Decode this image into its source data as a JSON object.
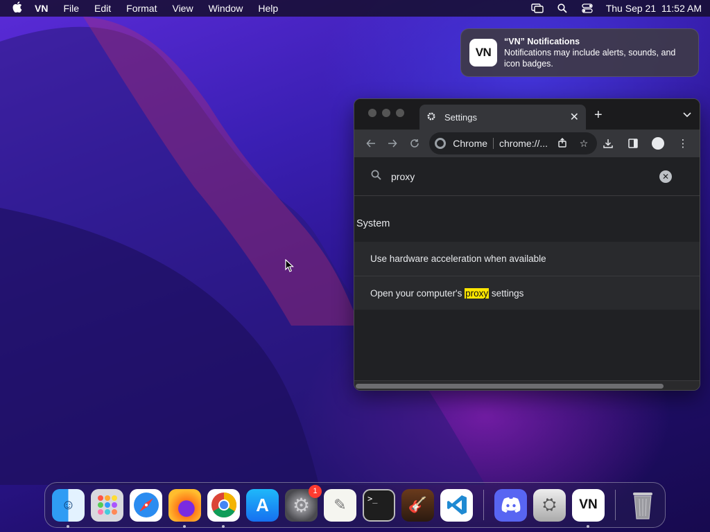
{
  "menubar": {
    "app_name": "VN",
    "items": [
      "File",
      "Edit",
      "Format",
      "View",
      "Window",
      "Help"
    ],
    "datetime": "Thu Sep 21  11:52 AM",
    "status_icons": [
      "screen-mirroring-icon",
      "spotlight-search-icon",
      "control-center-icon"
    ]
  },
  "notification": {
    "icon_text": "VN",
    "title": "“VN” Notifications",
    "body": "Notifications may include alerts, sounds, and icon badges."
  },
  "browser": {
    "tab": {
      "title": "Settings",
      "icon": "gear-icon"
    },
    "omnibox": {
      "label": "Chrome",
      "url": "chrome://..."
    },
    "search": {
      "value": "proxy"
    },
    "section_title": "System",
    "rows": [
      {
        "label": "Use hardware acceleration when available"
      },
      {
        "pre": "Open your computer's ",
        "highlight": "proxy",
        "post": " settings"
      }
    ],
    "highlight_color": "#ffe600"
  },
  "dock": {
    "apps": [
      {
        "name": "Finder",
        "running": true
      },
      {
        "name": "Launchpad",
        "running": false
      },
      {
        "name": "Safari",
        "running": false
      },
      {
        "name": "Firefox",
        "running": true
      },
      {
        "name": "Chrome",
        "running": true
      },
      {
        "name": "App Store",
        "running": false
      },
      {
        "name": "System Preferences",
        "running": false,
        "badge": "1"
      },
      {
        "name": "TextEdit",
        "running": false
      },
      {
        "name": "Terminal",
        "running": false
      },
      {
        "name": "GarageBand",
        "running": false
      },
      {
        "name": "VS Code",
        "running": false
      },
      {
        "name": "Discord",
        "running": false
      },
      {
        "name": "Utility",
        "running": false
      },
      {
        "name": "VN",
        "running": true
      },
      {
        "name": "Trash",
        "running": false
      }
    ]
  }
}
